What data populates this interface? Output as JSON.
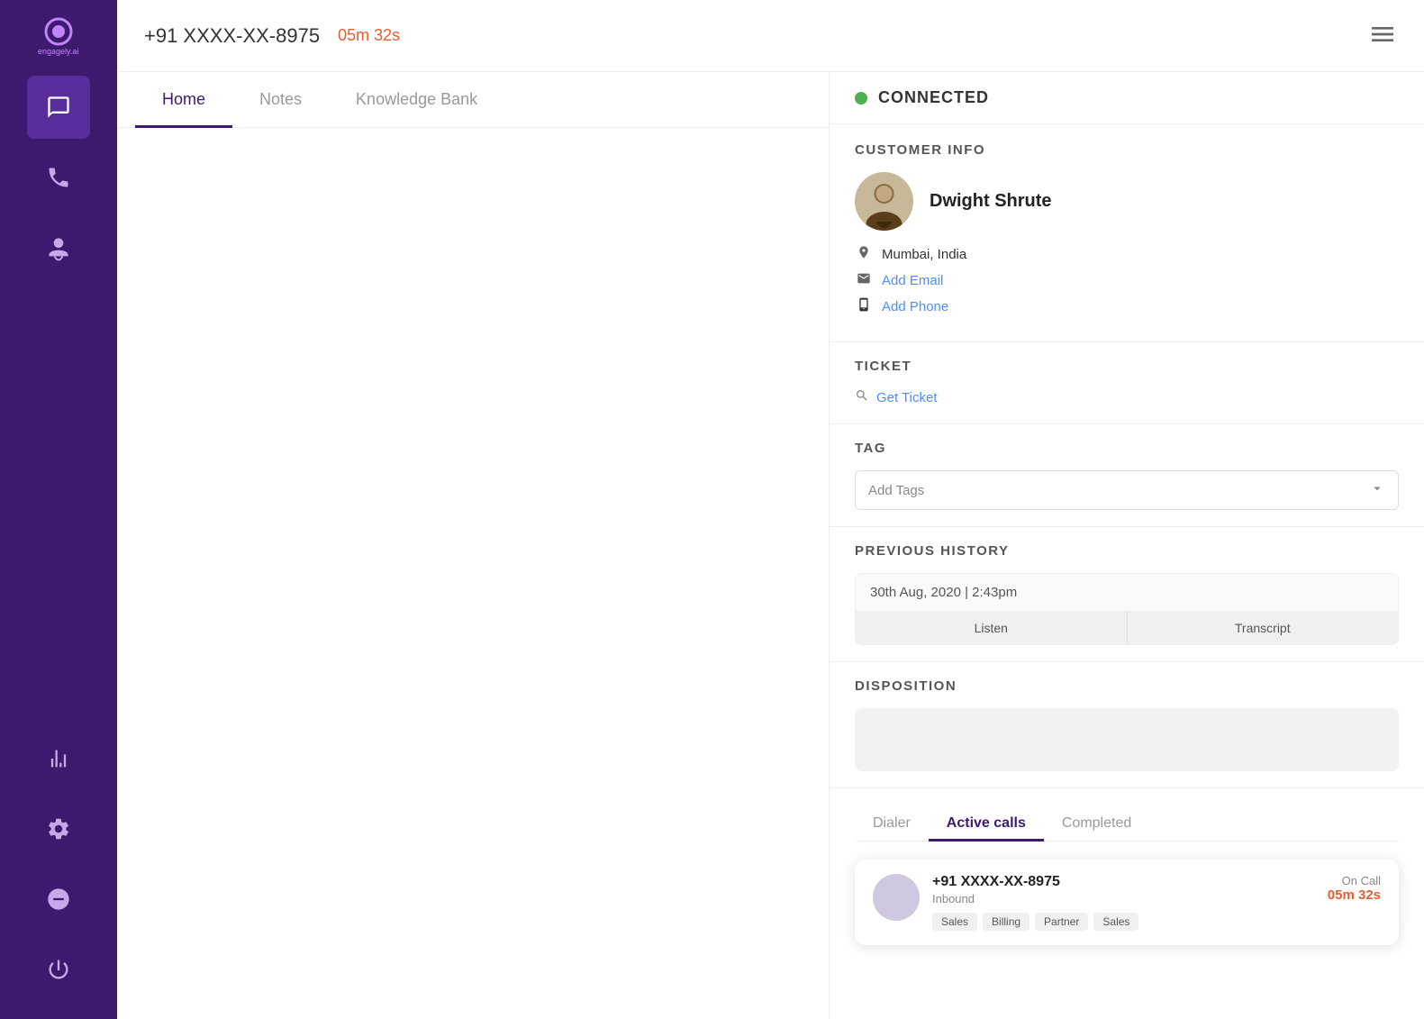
{
  "sidebar": {
    "logo_alt": "engagely.ai",
    "items": [
      {
        "id": "chat",
        "icon": "💬",
        "label": "Chat",
        "active": true
      },
      {
        "id": "phone",
        "icon": "📞",
        "label": "Phone",
        "active": false
      },
      {
        "id": "agent",
        "icon": "👤",
        "label": "Agent",
        "active": false
      },
      {
        "id": "analytics",
        "icon": "📊",
        "label": "Analytics",
        "active": false
      },
      {
        "id": "settings",
        "icon": "⚙️",
        "label": "Settings",
        "active": false
      },
      {
        "id": "block",
        "icon": "⊖",
        "label": "Block",
        "active": false
      },
      {
        "id": "power",
        "icon": "⏻",
        "label": "Power",
        "active": false
      }
    ]
  },
  "topbar": {
    "phone_number": "+91 XXXX-XX-8975",
    "timer": "05m 32s",
    "menu_icon": "≡"
  },
  "tabs": [
    {
      "id": "home",
      "label": "Home",
      "active": true
    },
    {
      "id": "notes",
      "label": "Notes",
      "active": false
    },
    {
      "id": "knowledge_bank",
      "label": "Knowledge Bank",
      "active": false
    }
  ],
  "connected": {
    "status": "CONNECTED"
  },
  "customer_info": {
    "section_title": "CUSTOMER INFO",
    "name": "Dwight Shrute",
    "location": "Mumbai, India",
    "add_email_label": "Add Email",
    "add_phone_label": "Add Phone"
  },
  "ticket": {
    "section_title": "TICKET",
    "get_ticket_label": "Get Ticket"
  },
  "tag": {
    "section_title": "TAG",
    "placeholder": "Add Tags"
  },
  "previous_history": {
    "section_title": "PREVIOUS HISTORY",
    "date": "30th Aug, 2020 | 2:43pm",
    "listen_label": "Listen",
    "transcript_label": "Transcript"
  },
  "disposition": {
    "section_title": "DISPOSITION"
  },
  "bottom_tabs": [
    {
      "id": "dialer",
      "label": "Dialer",
      "active": false
    },
    {
      "id": "active_calls",
      "label": "Active calls",
      "active": true
    },
    {
      "id": "completed",
      "label": "Completed",
      "active": false
    }
  ],
  "active_call": {
    "phone": "+91 XXXX-XX-8975",
    "direction": "Inbound",
    "status_label": "On Call",
    "duration": "05m 32s",
    "tags": [
      "Sales",
      "Billing",
      "Partner",
      "Sales"
    ]
  }
}
